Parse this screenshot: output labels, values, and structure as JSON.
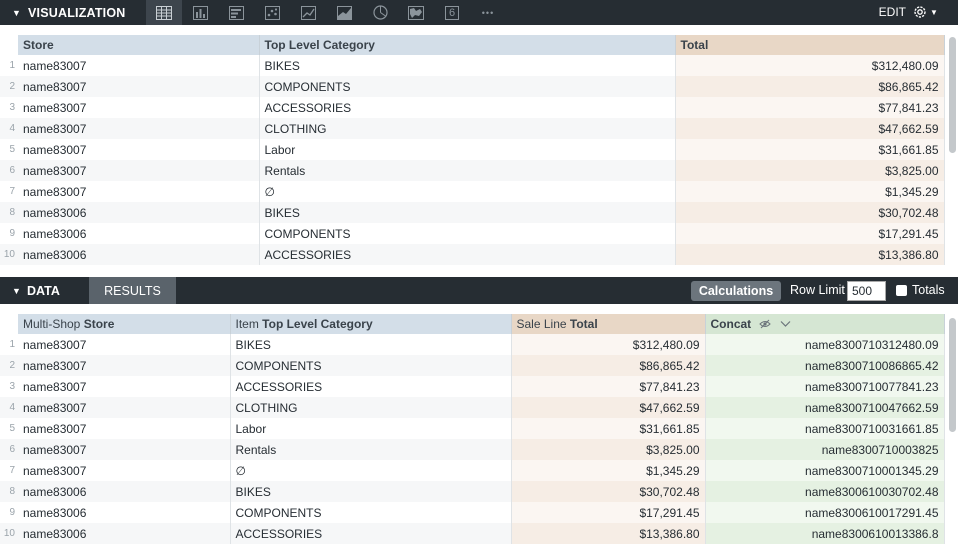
{
  "visualization": {
    "title": "VISUALIZATION",
    "edit_label": "EDIT",
    "icons": [
      "table-icon",
      "bar-chart-icon",
      "column-chart-icon",
      "scatter-icon",
      "line-chart-icon",
      "area-chart-icon",
      "pie-chart-icon",
      "map-icon",
      "single-value-icon",
      "more-icon"
    ],
    "single_value_glyph": "6",
    "more_glyph": "•••",
    "columns": [
      "Store",
      "Top Level Category",
      "Total"
    ],
    "rows": [
      {
        "n": "1",
        "store": "name83007",
        "cat": "BIKES",
        "total": "$312,480.09"
      },
      {
        "n": "2",
        "store": "name83007",
        "cat": "COMPONENTS",
        "total": "$86,865.42"
      },
      {
        "n": "3",
        "store": "name83007",
        "cat": "ACCESSORIES",
        "total": "$77,841.23"
      },
      {
        "n": "4",
        "store": "name83007",
        "cat": "CLOTHING",
        "total": "$47,662.59"
      },
      {
        "n": "5",
        "store": "name83007",
        "cat": "Labor",
        "total": "$31,661.85"
      },
      {
        "n": "6",
        "store": "name83007",
        "cat": "Rentals",
        "total": "$3,825.00"
      },
      {
        "n": "7",
        "store": "name83007",
        "cat": "∅",
        "total": "$1,345.29"
      },
      {
        "n": "8",
        "store": "name83006",
        "cat": "BIKES",
        "total": "$30,702.48"
      },
      {
        "n": "9",
        "store": "name83006",
        "cat": "COMPONENTS",
        "total": "$17,291.45"
      },
      {
        "n": "10",
        "store": "name83006",
        "cat": "ACCESSORIES",
        "total": "$13,386.80"
      }
    ]
  },
  "data_panel": {
    "title": "DATA",
    "results_tab": "RESULTS",
    "calculations_button": "Calculations",
    "row_limit_label": "Row Limit",
    "row_limit_value": "500",
    "totals_label": "Totals",
    "columns": [
      {
        "prefix": "Multi-Shop ",
        "name": "Store"
      },
      {
        "prefix": "Item ",
        "name": "Top Level Category"
      },
      {
        "prefix": "Sale Line ",
        "name": "Total"
      },
      {
        "prefix": "",
        "name": "Concat"
      }
    ],
    "rows": [
      {
        "n": "1",
        "store": "name83007",
        "cat": "BIKES",
        "total": "$312,480.09",
        "concat": "name8300710312480.09"
      },
      {
        "n": "2",
        "store": "name83007",
        "cat": "COMPONENTS",
        "total": "$86,865.42",
        "concat": "name8300710086865.42"
      },
      {
        "n": "3",
        "store": "name83007",
        "cat": "ACCESSORIES",
        "total": "$77,841.23",
        "concat": "name8300710077841.23"
      },
      {
        "n": "4",
        "store": "name83007",
        "cat": "CLOTHING",
        "total": "$47,662.59",
        "concat": "name8300710047662.59"
      },
      {
        "n": "5",
        "store": "name83007",
        "cat": "Labor",
        "total": "$31,661.85",
        "concat": "name8300710031661.85"
      },
      {
        "n": "6",
        "store": "name83007",
        "cat": "Rentals",
        "total": "$3,825.00",
        "concat": "name8300710003825"
      },
      {
        "n": "7",
        "store": "name83007",
        "cat": "∅",
        "total": "$1,345.29",
        "concat": "name8300710001345.29"
      },
      {
        "n": "8",
        "store": "name83006",
        "cat": "BIKES",
        "total": "$30,702.48",
        "concat": "name8300610030702.48"
      },
      {
        "n": "9",
        "store": "name83006",
        "cat": "COMPONENTS",
        "total": "$17,291.45",
        "concat": "name8300610017291.45"
      },
      {
        "n": "10",
        "store": "name83006",
        "cat": "ACCESSORIES",
        "total": "$13,386.80",
        "concat": "name8300610013386.8"
      }
    ]
  }
}
